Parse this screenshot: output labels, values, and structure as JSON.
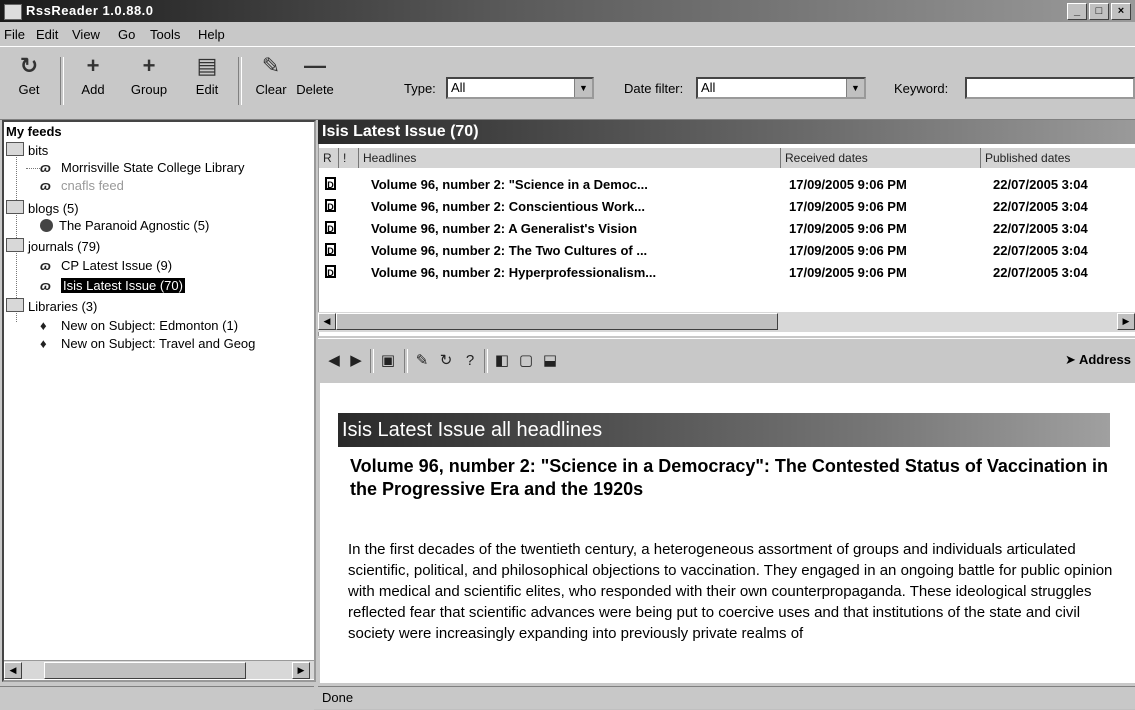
{
  "window": {
    "title": "RssReader 1.0.88.0",
    "minimize": "_",
    "maximize": "□",
    "close": "×"
  },
  "menu": [
    "File",
    "Edit",
    "View",
    "Go",
    "Tools",
    "Help"
  ],
  "toolbar": {
    "buttons": [
      {
        "label": "Get",
        "icon": "↻"
      },
      {
        "label": "Add",
        "icon": "+"
      },
      {
        "label": "Group",
        "icon": "+"
      },
      {
        "label": "Edit",
        "icon": "▤"
      },
      {
        "label": "Clear",
        "icon": "✎"
      },
      {
        "label": "Delete",
        "icon": "—"
      }
    ],
    "type_label": "Type:",
    "type_value": "All",
    "date_filter_label": "Date filter:",
    "date_filter_value": "All",
    "keyword_label": "Keyword:"
  },
  "tree": {
    "root": "My feeds",
    "groups": [
      {
        "name": "bits",
        "feeds": [
          "Morrisville State College Library",
          "cnafls feed"
        ]
      },
      {
        "name": "blogs (5)",
        "feeds": [
          "The Paranoid Agnostic (5)"
        ]
      },
      {
        "name": "journals (79)",
        "feeds": [
          "CP Latest Issue (9)",
          "Isis Latest Issue (70)"
        ]
      },
      {
        "name": "Libraries (3)",
        "feeds": [
          "New on Subject: Edmonton (1)",
          "New on Subject: Travel and Geog"
        ]
      }
    ]
  },
  "list": {
    "title": "Isis Latest Issue (70)",
    "columns": [
      "R",
      "!",
      "Headlines",
      "Received dates",
      "Published dates"
    ],
    "rows": [
      {
        "headline": "Volume 96, number 2: \"Science in a Democ...",
        "received": "17/09/2005 9:06 PM",
        "published": "22/07/2005 3:04"
      },
      {
        "headline": "Volume 96, number 2: Conscientious Work...",
        "received": "17/09/2005 9:06 PM",
        "published": "22/07/2005 3:04"
      },
      {
        "headline": "Volume 96, number 2: A Generalist's Vision",
        "received": "17/09/2005 9:06 PM",
        "published": "22/07/2005 3:04"
      },
      {
        "headline": "Volume 96, number 2: The Two Cultures of ...",
        "received": "17/09/2005 9:06 PM",
        "published": "22/07/2005 3:04"
      },
      {
        "headline": "Volume 96, number 2: Hyperprofessionalism...",
        "received": "17/09/2005 9:06 PM",
        "published": "22/07/2005 3:04"
      }
    ]
  },
  "browser": {
    "address_label": "Address"
  },
  "content": {
    "banner": "Isis Latest Issue all headlines",
    "article_title": "Volume 96, number 2: \"Science in a Democracy\": The Contested Status of Vaccination in the Progressive Era and the 1920s",
    "article_body": "In the first decades of the twentieth century, a heterogeneous assortment of groups and individuals articulated scientific, political, and philosophical objections to vaccination. They engaged in an ongoing battle for public opinion with medical and scientific elites, who responded with their own counterpropaganda. These ideological struggles reflected fear that scientific advances were being put to coercive uses and that institutions of the state and civil society were increasingly expanding into previously private realms of"
  },
  "status": "Done"
}
